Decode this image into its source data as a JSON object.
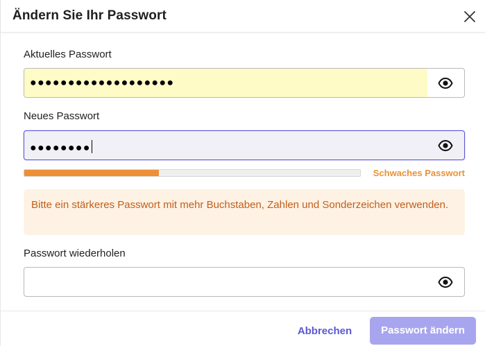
{
  "dialog": {
    "title": "Ändern Sie Ihr Passwort",
    "close_icon": "close-icon"
  },
  "current_password": {
    "label": "Aktuelles Passwort",
    "masked_value": "●●●●●●●●●●●●●●●●●●●",
    "autofilled": true,
    "toggle_icon": "eye-icon"
  },
  "new_password": {
    "label": "Neues Passwort",
    "masked_value": "●●●●●●●●",
    "focused": true,
    "toggle_icon": "eye-icon"
  },
  "strength": {
    "label": "Schwaches Passwort",
    "level_percent": 40,
    "color": "#ee8f35"
  },
  "hint": {
    "text": "Bitte ein stärkeres Passwort mit mehr Buchstaben, Zahlen und Sonderzeichen verwenden."
  },
  "repeat_password": {
    "label": "Passwort wiederholen",
    "value": "",
    "toggle_icon": "eye-icon"
  },
  "footer": {
    "cancel_label": "Abbrechen",
    "submit_label": "Passwort ändern",
    "submit_disabled": true
  },
  "colors": {
    "accent": "#5b57d6",
    "accent_disabled": "#a8a5ef",
    "warning_text": "#c35e1b",
    "warning_bg": "#fdf2e3",
    "autofill_bg": "#fefbc6"
  }
}
